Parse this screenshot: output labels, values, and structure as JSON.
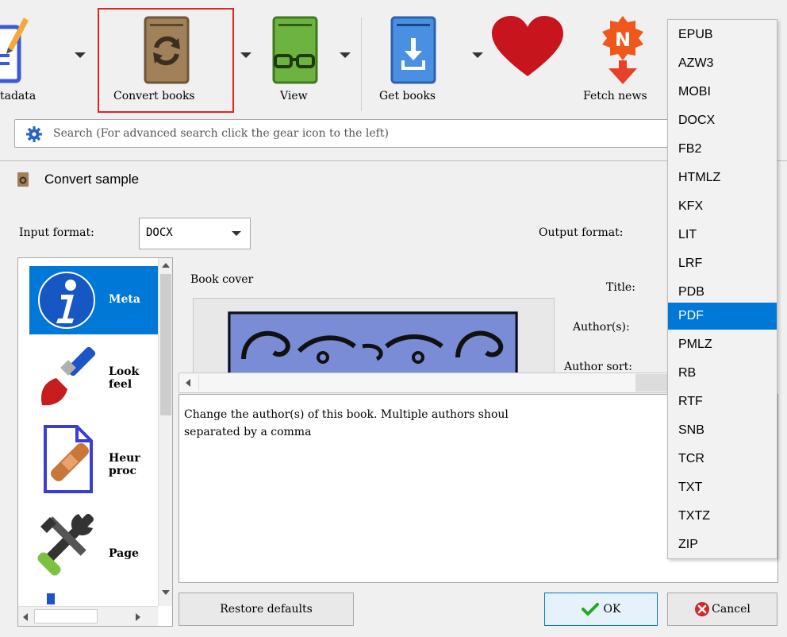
{
  "toolbar": {
    "edit_metadata_label": "tadata",
    "convert_books_label": "Convert books",
    "view_label": "View",
    "get_books_label": "Get books",
    "fetch_news_label": "Fetch news"
  },
  "search": {
    "placeholder": "Search (For advanced search click the gear icon to the left)"
  },
  "dialog": {
    "title": "Convert sample",
    "input_format_label": "Input format:",
    "input_format_value": "DOCX",
    "output_format_label": "Output format:",
    "sidebar": [
      {
        "label": "Meta"
      },
      {
        "label": "Look\nfeel"
      },
      {
        "label": "Heur\nproc"
      },
      {
        "label": "Page"
      }
    ],
    "book_cover_label": "Book cover",
    "fields": {
      "title_label": "Title:",
      "authors_label": "Author(s):",
      "author_sort_label": "Author sort:"
    },
    "help_text": "Change the author(s) of this book. Multiple authors shoul\nseparated by a comma",
    "restore_defaults_label": "Restore defaults",
    "ok_label": "OK",
    "cancel_label": "Cancel"
  },
  "format_menu": {
    "items": [
      "EPUB",
      "AZW3",
      "MOBI",
      "DOCX",
      "FB2",
      "HTMLZ",
      "KFX",
      "LIT",
      "LRF",
      "PDB",
      "PDF",
      "PMLZ",
      "RB",
      "RTF",
      "SNB",
      "TCR",
      "TXT",
      "TXTZ",
      "ZIP"
    ],
    "selected": "PDF"
  },
  "colors": {
    "highlight_border": "#e0242a",
    "selection": "#0078d7",
    "ok_check": "#22aa22",
    "cancel_icon": "#d0282e"
  }
}
